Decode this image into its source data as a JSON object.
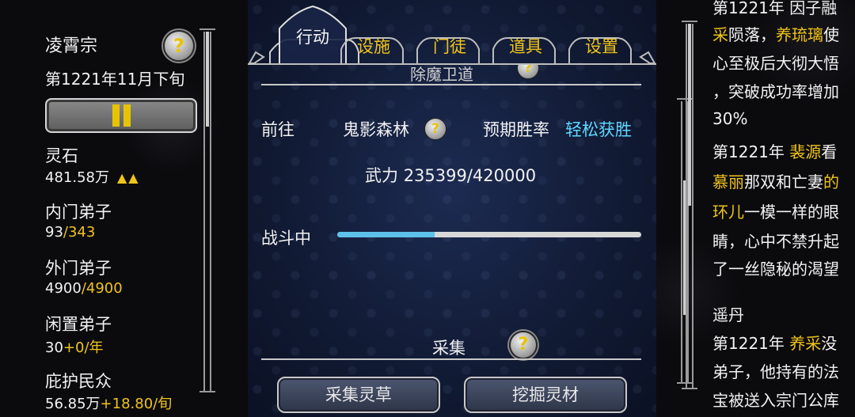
{
  "left": {
    "sect_name": "凌霄宗",
    "help_glyph": "?",
    "date": "第1221年11月下旬",
    "stats": [
      {
        "label": "灵石",
        "value": "481.58万",
        "extra": "",
        "trend": "▲▲"
      },
      {
        "label": "内门弟子",
        "value": "93",
        "extra": "/343",
        "trend": ""
      },
      {
        "label": "外门弟子",
        "value": "4900",
        "extra": "/4900",
        "trend": ""
      },
      {
        "label": "闲置弟子",
        "value": "30",
        "extra": "+0/年",
        "trend": ""
      },
      {
        "label": "庇护民众",
        "value": "56.85万",
        "extra": "+18.80/旬",
        "trend": ""
      }
    ]
  },
  "tabs": [
    {
      "label": "行动",
      "active": true
    },
    {
      "label": "设施",
      "active": false
    },
    {
      "label": "门徒",
      "active": false
    },
    {
      "label": "道具",
      "active": false
    },
    {
      "label": "设置",
      "active": false
    }
  ],
  "center": {
    "prev_title": "除魔卫道",
    "goto_label": "前往",
    "destination": "鬼影森林",
    "expect_label": "预期胜率",
    "expect_value": "轻松获胜",
    "force_label": "武力",
    "force_value": "235399/420000",
    "battle_label": "战斗中",
    "battle_progress": 0.32,
    "collect_title": "采集",
    "btn_herb": "采集灵草",
    "btn_ore": "挖掘灵材"
  },
  "right": {
    "lines": [
      {
        "parts": [
          {
            "t": "第1221年 因子融",
            "c": "w"
          }
        ]
      },
      {
        "parts": [
          {
            "t": "采",
            "c": "y"
          },
          {
            "t": "陨落，",
            "c": "w"
          },
          {
            "t": "养琉璃",
            "c": "y"
          },
          {
            "t": "使",
            "c": "w"
          }
        ]
      },
      {
        "parts": [
          {
            "t": "心至极后大彻大悟",
            "c": "w"
          }
        ]
      },
      {
        "parts": [
          {
            "t": "，突破成功率增加",
            "c": "w"
          }
        ]
      },
      {
        "parts": [
          {
            "t": "30%",
            "c": "w"
          }
        ]
      },
      {
        "parts": [
          {
            "t": "第1221年 ",
            "c": "w"
          },
          {
            "t": "裴源",
            "c": "y"
          },
          {
            "t": "看",
            "c": "w"
          }
        ]
      },
      {
        "parts": [
          {
            "t": "慕丽",
            "c": "y"
          },
          {
            "t": "那双和亡妻",
            "c": "w"
          },
          {
            "t": "的",
            "c": "y"
          }
        ]
      },
      {
        "parts": [
          {
            "t": "环儿",
            "c": "y"
          },
          {
            "t": "一模一样的眼",
            "c": "w"
          }
        ]
      },
      {
        "parts": [
          {
            "t": "睛，心中不禁升起",
            "c": "w"
          }
        ]
      },
      {
        "parts": [
          {
            "t": "了一丝隐秘的渴望",
            "c": "w"
          }
        ]
      },
      {
        "parts": [
          {
            "t": "遥丹",
            "c": "w"
          }
        ]
      },
      {
        "parts": [
          {
            "t": "第1221年 ",
            "c": "w"
          },
          {
            "t": "养采",
            "c": "y"
          },
          {
            "t": "没",
            "c": "w"
          }
        ]
      },
      {
        "parts": [
          {
            "t": "弟子，他持有的法",
            "c": "w"
          }
        ]
      },
      {
        "parts": [
          {
            "t": "宝被送入宗门公库",
            "c": "w"
          }
        ]
      }
    ]
  }
}
